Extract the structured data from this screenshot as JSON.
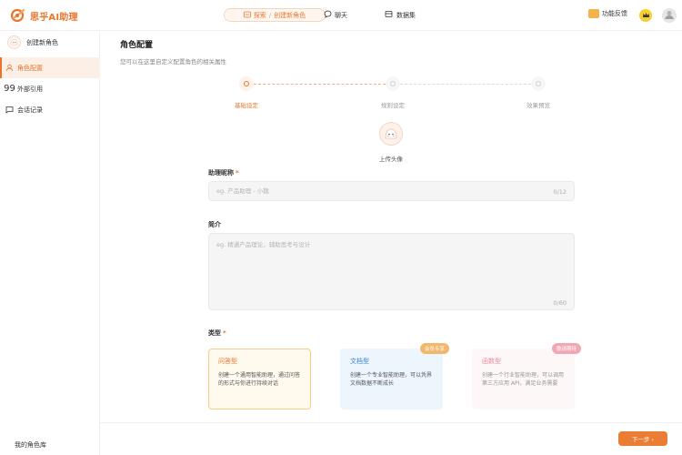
{
  "header": {
    "brand": "思乎AI助理",
    "nav_pill": {
      "explore": "探索",
      "separator": "/",
      "current": "创建新角色"
    },
    "nav_chat": "聊天",
    "nav_data": "数据集",
    "feedback": "功能反馈"
  },
  "sidebar": {
    "new_role": "创建新角色",
    "items": [
      {
        "label": "角色配置",
        "icon": "user-icon",
        "active": true
      },
      {
        "label": "外部引用",
        "icon": "quote-icon",
        "active": false
      },
      {
        "label": "会话记录",
        "icon": "chat-icon",
        "active": false
      }
    ],
    "footer": "我的角色库"
  },
  "main": {
    "title": "角色配置",
    "subtitle": "您可以在这里自定义配置角色的相关属性",
    "steps": [
      {
        "label": "基础设定",
        "active": true
      },
      {
        "label": "规则设定",
        "active": false
      },
      {
        "label": "效果预览",
        "active": false
      }
    ],
    "upload_label": "上传头像",
    "name_field": {
      "label": "助理昵称",
      "required": "*",
      "placeholder": "eg. 产品助理 - 小魏",
      "counter": "0/12"
    },
    "intro_field": {
      "label": "简介",
      "placeholder": "eg. 精通产品理论，辅助思考与设计",
      "counter": "0/60"
    },
    "type_label": "类型",
    "type_required": "*",
    "types": [
      {
        "title": "问答型",
        "desc": "创建一个通用智能助理，通过问答的形式与你进行持续对话",
        "badge": ""
      },
      {
        "title": "文档型",
        "desc": "创建一个专业智能助理，可以凭界文档数据不断成长",
        "badge": "会员专享"
      },
      {
        "title": "函数型",
        "desc": "创建一个行业智能助理，可以调用第三方应用 API，满足业务需要",
        "badge": "敬请期待"
      }
    ],
    "next_button": "下一步 ›"
  }
}
